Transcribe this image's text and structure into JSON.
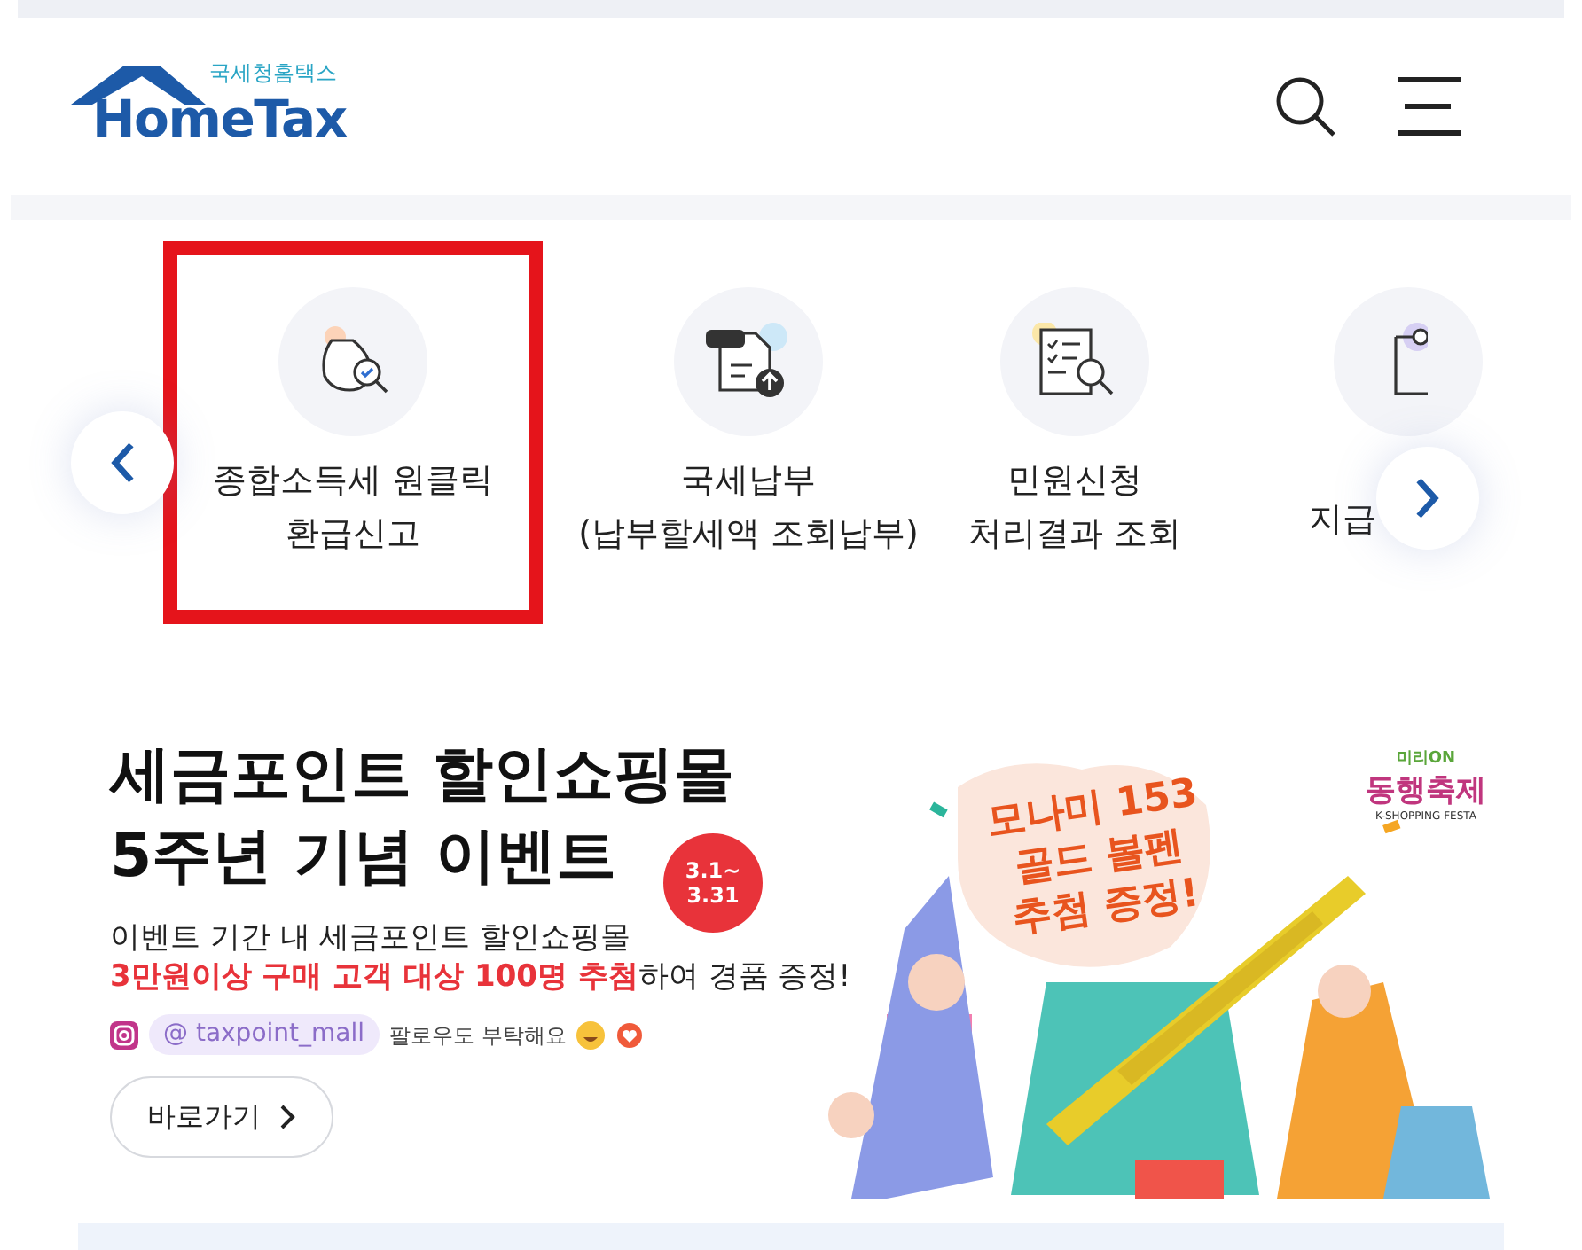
{
  "header": {
    "logo_small": "국세청홈택스",
    "logo_text": "HomeTax"
  },
  "quick_menu": {
    "items": [
      {
        "kind": "refund",
        "lines": [
          "종합소득세 원클릭",
          "환급신고"
        ],
        "highlighted": true
      },
      {
        "kind": "payment",
        "lines": [
          "국세납부",
          "(납부할세액 조회납부)"
        ],
        "highlighted": false
      },
      {
        "kind": "civil",
        "lines": [
          "민원신청",
          "처리결과 조회"
        ],
        "highlighted": false
      },
      {
        "kind": "document",
        "lines": [
          "지급"
        ],
        "highlighted": false
      }
    ]
  },
  "banner": {
    "title_lines": [
      "세금포인트 할인쇼핑몰",
      "5주년 기념 이벤트"
    ],
    "date_badge": [
      "3.1~",
      "3.31"
    ],
    "description": "이벤트 기간 내 세금포인트 할인쇼핑몰",
    "highlight": "**3만원이상 구매 고객 대상 100명 추첨**하여 경품 증정!",
    "instagram_handle": "@ taxpoint_mall",
    "follow_text": "팔로우도 부탁해요",
    "button": "바로가기",
    "prize_lines": [
      "모나미 153",
      "골드 볼펜",
      "추첨 증정!"
    ],
    "festival": {
      "top": "미리ON",
      "name": "동행축제",
      "sub": "K-SHOPPING FESTA"
    }
  }
}
